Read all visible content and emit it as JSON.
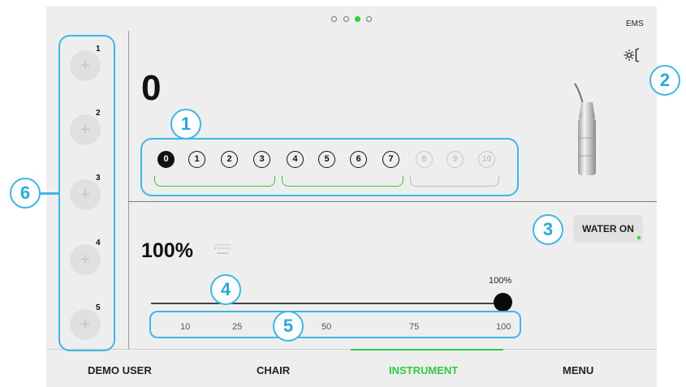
{
  "header": {
    "page_dots": [
      {
        "active": false
      },
      {
        "active": false
      },
      {
        "active": true
      },
      {
        "active": false
      }
    ],
    "brand": "EMS",
    "light_icon": "light-icon"
  },
  "presets": [
    {
      "number": "1",
      "icon": "plus-icon"
    },
    {
      "number": "2",
      "icon": "plus-icon"
    },
    {
      "number": "3",
      "icon": "plus-icon"
    },
    {
      "number": "4",
      "icon": "plus-icon"
    },
    {
      "number": "5",
      "icon": "plus-icon"
    }
  ],
  "power": {
    "current_value": "0",
    "levels": [
      "0",
      "1",
      "2",
      "3",
      "4",
      "5",
      "6",
      "7",
      "8",
      "9",
      "10"
    ],
    "selected_level": "0",
    "disabled_levels": [
      "8",
      "9",
      "10"
    ]
  },
  "water": {
    "button_label": "WATER ON",
    "status_color": "#2ecc40",
    "percentage_value": "100%",
    "slider_value_label": "100%",
    "slider_value": 100,
    "scale_ticks": [
      "10",
      "25",
      "50",
      "75",
      "100"
    ],
    "icon": "water-flow-icon"
  },
  "callouts": [
    "1",
    "2",
    "3",
    "4",
    "5",
    "6"
  ],
  "bottom_nav": {
    "items": [
      "DEMO USER",
      "CHAIR",
      "INSTRUMENT",
      "MENU"
    ],
    "active": "INSTRUMENT",
    "active_color": "#2ecc40"
  }
}
